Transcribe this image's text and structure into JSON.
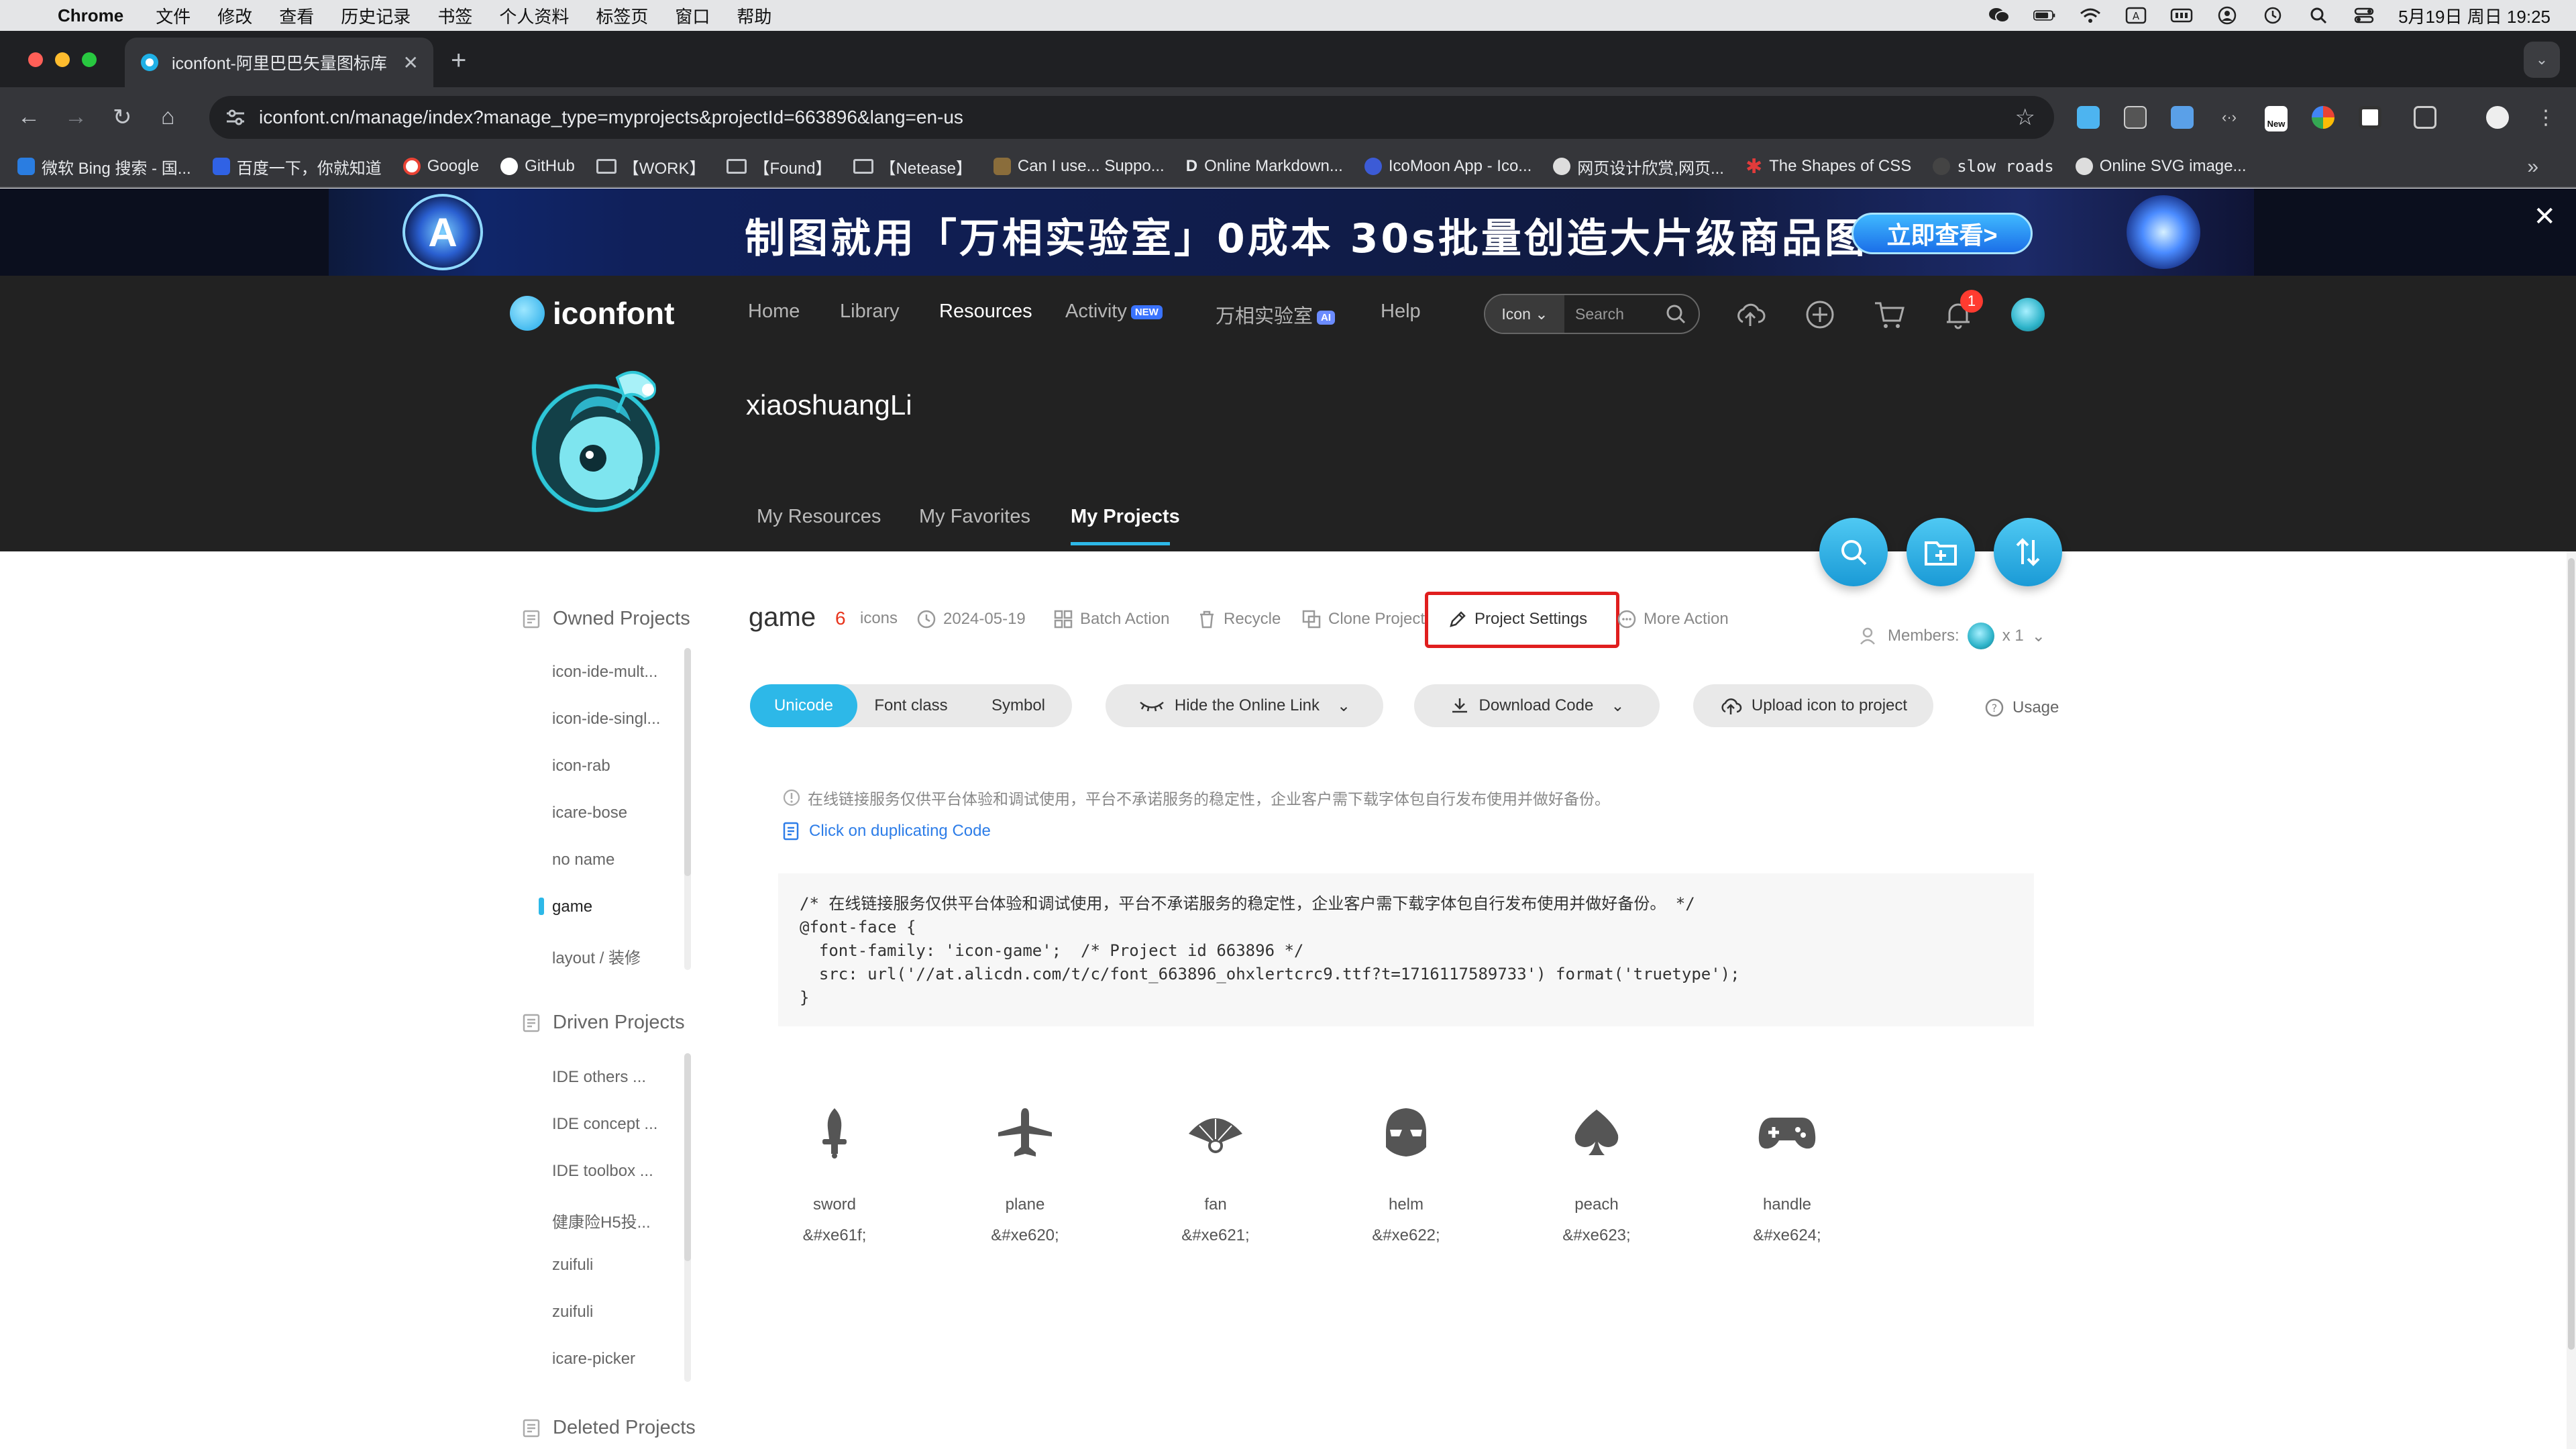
{
  "menubar": {
    "app": "Chrome",
    "menus": [
      "文件",
      "修改",
      "查看",
      "历史记录",
      "书签",
      "个人资料",
      "标签页",
      "窗口",
      "帮助"
    ],
    "clock": "5月19日 周日  19:25"
  },
  "browser": {
    "tab_title": "iconfont-阿里巴巴矢量图标库",
    "url": "iconfont.cn/manage/index?manage_type=myprojects&projectId=663896&lang=en-us",
    "bookmarks": [
      "微软 Bing 搜索 - 国...",
      "百度一下，你就知道",
      "Google",
      "GitHub",
      "【WORK】",
      "【Found】",
      "【Netease】",
      "Can I use... Suppo...",
      "Online Markdown...",
      "IcoMoon App - Ico...",
      "网页设计欣赏,网页...",
      "The Shapes of CSS",
      "slow roads",
      "Online SVG image..."
    ],
    "ext_new_badge": "New"
  },
  "banner": {
    "headline": "制图就用「万相实验室」0成本 30s批量创造大片级商品图",
    "cta": "立即查看>",
    "logo_letter": "A"
  },
  "site": {
    "brand": "iconfont",
    "nav": [
      "Home",
      "Library",
      "Resources",
      "Activity",
      "万相实验室",
      "Help"
    ],
    "nav_new_tag": "NEW",
    "nav_ai_tag": "AI",
    "search_type": "Icon",
    "search_placeholder": "Search",
    "notification_count": "1",
    "username": "xiaoshuangLi",
    "subtabs": [
      "My Resources",
      "My Favorites",
      "My Projects"
    ]
  },
  "sidebar": {
    "owned_title": "Owned Projects",
    "owned": [
      "icon-ide-mult...",
      "icon-ide-singl...",
      "icon-rab",
      "icare-bose",
      "no name",
      "game",
      "layout / 装修"
    ],
    "driven_title": "Driven Projects",
    "driven": [
      "IDE others ...",
      "IDE concept ...",
      "IDE toolbox ...",
      "健康险H5投...",
      "zuifuli",
      "zuifuli",
      "icare-picker"
    ],
    "deleted_title": "Deleted Projects"
  },
  "project": {
    "name": "game",
    "count": "6",
    "count_unit": "icons",
    "date": "2024-05-19",
    "actions": [
      "Batch Action",
      "Recycle",
      "Clone Project",
      "Project Settings",
      "More Action"
    ],
    "members_label": "Members:",
    "members_count": "x 1",
    "modes": [
      "Unicode",
      "Font class",
      "Symbol"
    ],
    "hide_link": "Hide the Online Link",
    "download": "Download Code",
    "upload": "Upload icon to project",
    "usage": "Usage",
    "notice": "在线链接服务仅供平台体验和调试使用，平台不承诺服务的稳定性，企业客户需下载字体包自行发布使用并做好备份。",
    "copy_link": "Click on duplicating Code",
    "code_lines": [
      "/* 在线链接服务仅供平台体验和调试使用，平台不承诺服务的稳定性，企业客户需下载字体包自行发布使用并做好备份。 */",
      "@font-face {",
      "  font-family: 'icon-game';  /* Project id 663896 */",
      "  src: url('//at.alicdn.com/t/c/font_663896_ohxlertcrc9.ttf?t=1716117589733') format('truetype');",
      "}"
    ]
  },
  "icons": [
    {
      "name": "sword",
      "code": "&#xe61f;"
    },
    {
      "name": "plane",
      "code": "&#xe620;"
    },
    {
      "name": "fan",
      "code": "&#xe621;"
    },
    {
      "name": "helm",
      "code": "&#xe622;"
    },
    {
      "name": "peach",
      "code": "&#xe623;"
    },
    {
      "name": "handle",
      "code": "&#xe624;"
    }
  ],
  "colors": {
    "accent": "#2db8e8",
    "highlight": "#e01e1e",
    "header_bg": "#222222"
  }
}
